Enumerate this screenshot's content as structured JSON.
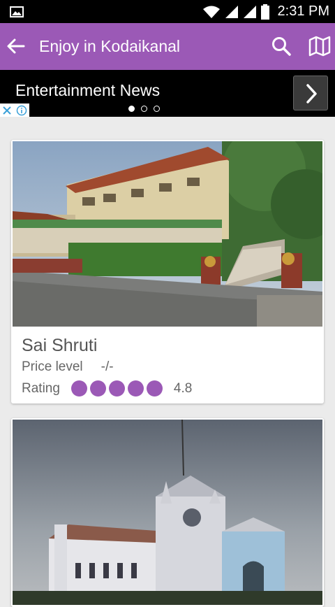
{
  "status": {
    "time": "2:31 PM"
  },
  "appbar": {
    "title": "Enjoy in Kodaikanal"
  },
  "ad": {
    "title": "Entertainment News"
  },
  "cards": [
    {
      "name": "Sai Shruti",
      "price_label": "Price level",
      "price_value": "-/-",
      "rating_label": "Rating",
      "rating_value": "4.8"
    }
  ],
  "colors": {
    "accent": "#9b59b6"
  }
}
